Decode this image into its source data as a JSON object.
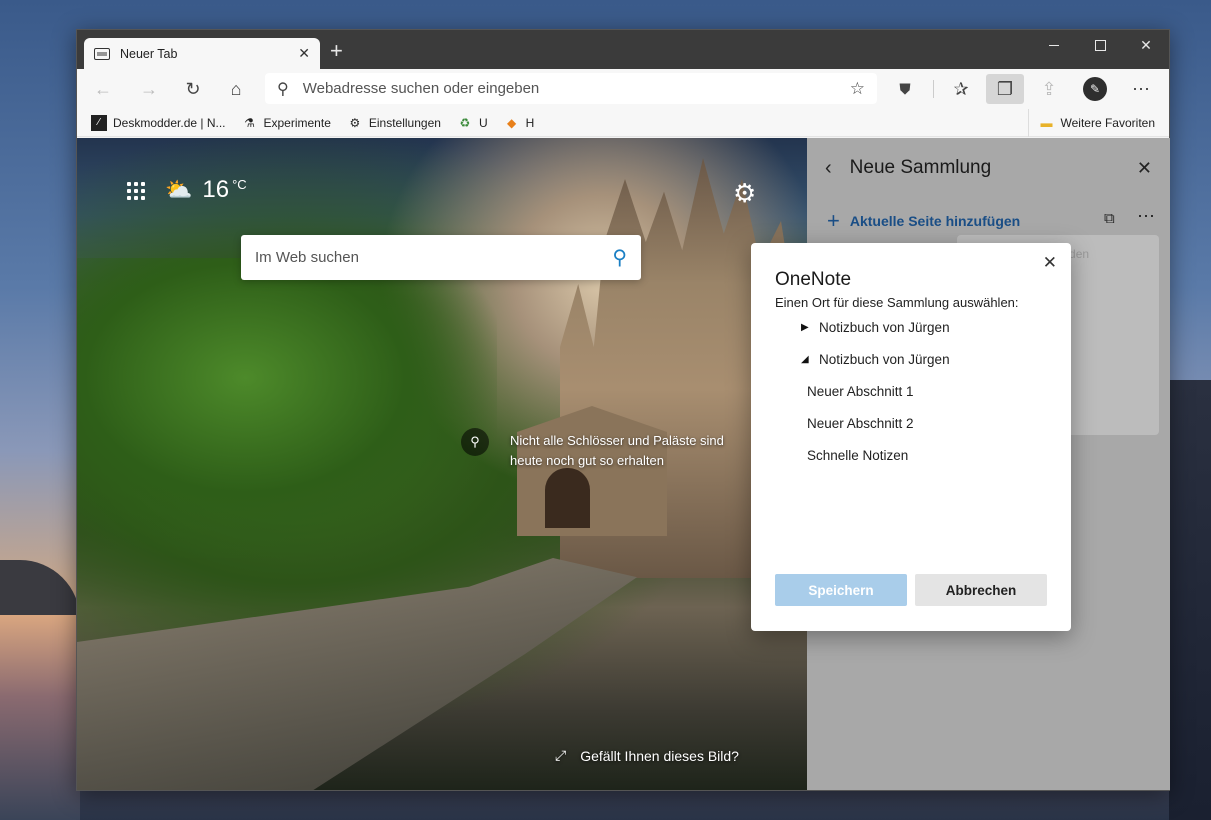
{
  "tab": {
    "title": "Neuer Tab"
  },
  "toolbar": {
    "address_placeholder": "Webadresse suchen oder eingeben"
  },
  "favorites": {
    "items": [
      {
        "label": "Deskmodder.de | N..."
      },
      {
        "label": "Experimente"
      },
      {
        "label": "Einstellungen"
      },
      {
        "label": "U"
      },
      {
        "label": "H"
      }
    ],
    "more_label": "Weitere Favoriten"
  },
  "newtab": {
    "weather_temp": "16",
    "weather_unit": "°C",
    "search_placeholder": "Im Web suchen",
    "image_info": "Nicht alle Schlösser und Paläste sind heute noch gut so erhalten",
    "like_image": "Gefällt Ihnen dieses Bild?"
  },
  "collections": {
    "title": "Neue Sammlung",
    "add_current": "Aktuelle Seite hinzufügen",
    "menu_item": "An Excel senden"
  },
  "dialog": {
    "title": "OneNote",
    "subtitle": "Einen Ort für diese Sammlung auswählen:",
    "tree": [
      {
        "label": "Notizbuch von Jürgen",
        "caret": "▶"
      },
      {
        "label": "Notizbuch von Jürgen",
        "caret": "◢"
      },
      {
        "label": "Neuer Abschnitt 1"
      },
      {
        "label": "Neuer Abschnitt 2"
      },
      {
        "label": "Schnelle Notizen"
      }
    ],
    "save_label": "Speichern",
    "cancel_label": "Abbrechen"
  },
  "colors": {
    "accent": "#1a4e86",
    "save_disabled": "#a9cdea",
    "titlebar": "#3b3b3b"
  }
}
